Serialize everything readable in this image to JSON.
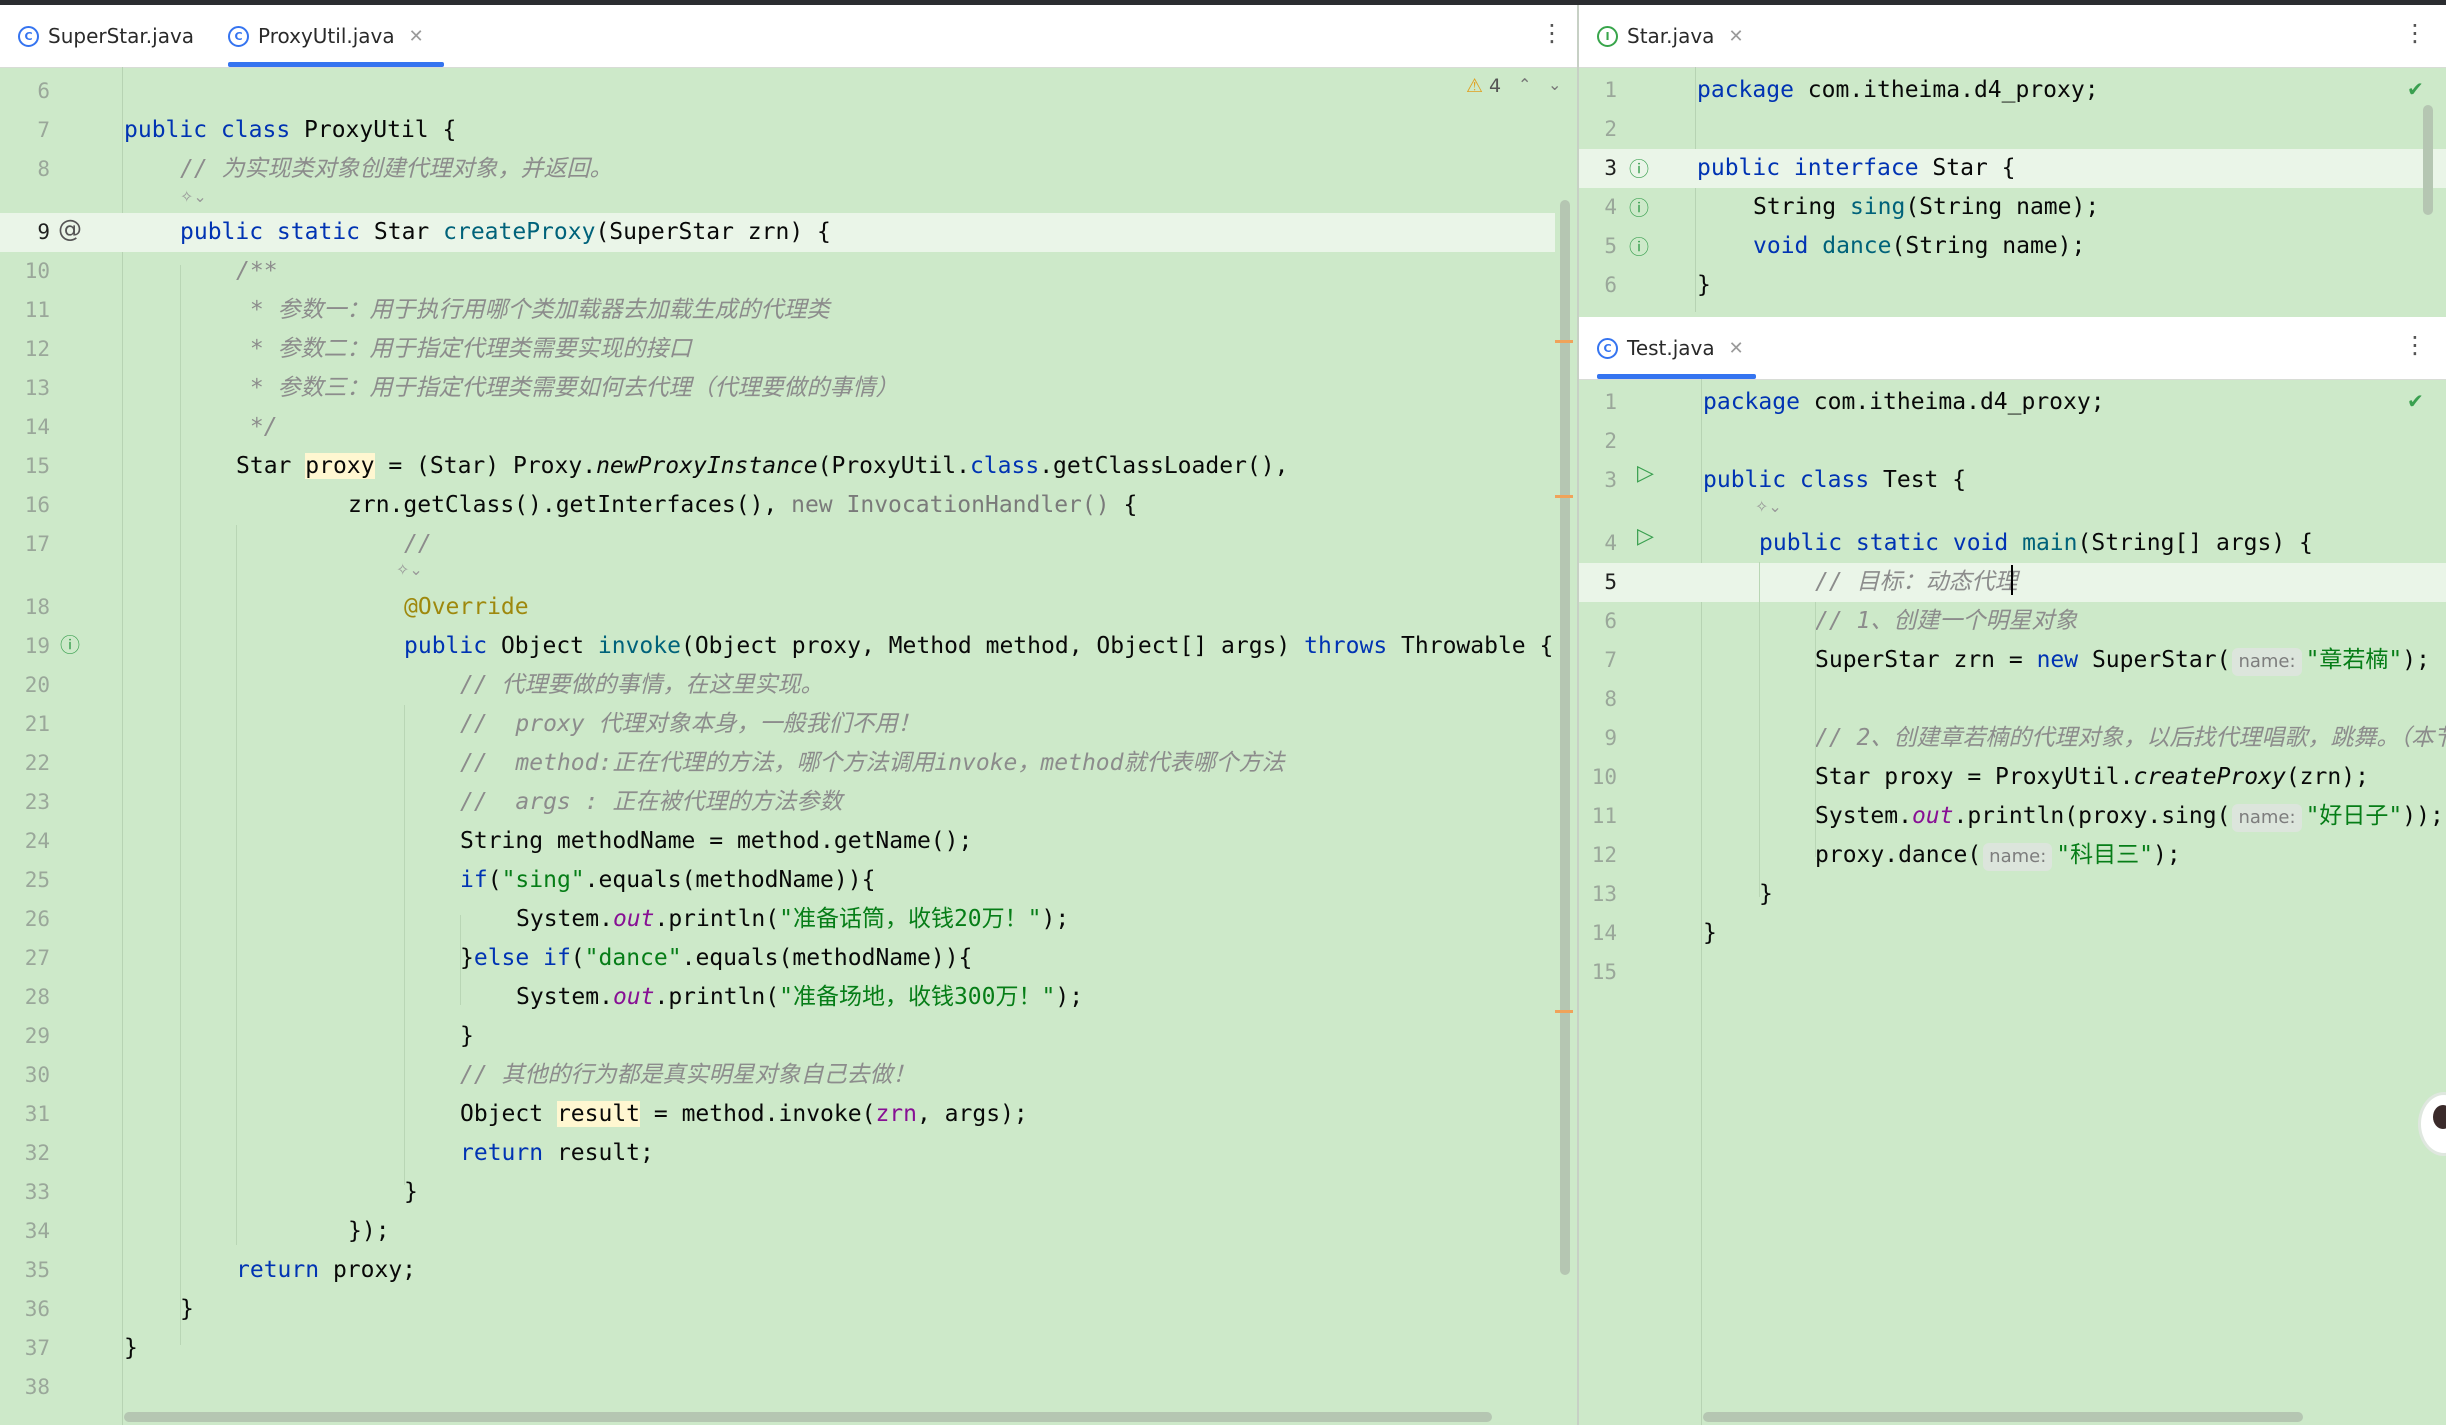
{
  "left_pane": {
    "tabs": [
      {
        "label": "SuperStar.java",
        "active": false,
        "closable": false
      },
      {
        "label": "ProxyUtil.java",
        "active": true,
        "closable": true
      }
    ],
    "problems": {
      "warnings": "4"
    },
    "lines": [
      {
        "n": "6",
        "indent": 0,
        "seg": []
      },
      {
        "n": "7",
        "indent": 0,
        "seg": [
          [
            "kw",
            "public class "
          ],
          [
            "",
            "ProxyUtil {"
          ]
        ]
      },
      {
        "n": "8",
        "indent": 1,
        "seg": [
          [
            "cm",
            "// 为实现类对象创建代理对象，并返回。"
          ]
        ]
      },
      {
        "n": "9",
        "indent": 1,
        "cur": true,
        "seg": [
          [
            "kw",
            "public static "
          ],
          [
            "",
            "Star "
          ],
          [
            "fn",
            "createProxy"
          ],
          [
            "",
            "(SuperStar zrn) {"
          ]
        ]
      },
      {
        "n": "10",
        "indent": 2,
        "seg": [
          [
            "cm",
            "/**"
          ]
        ]
      },
      {
        "n": "11",
        "indent": 2,
        "seg": [
          [
            "cm",
            " * 参数一：用于执行用哪个类加载器去加载生成的代理类"
          ]
        ]
      },
      {
        "n": "12",
        "indent": 2,
        "seg": [
          [
            "cm",
            " * 参数二：用于指定代理类需要实现的接口"
          ]
        ]
      },
      {
        "n": "13",
        "indent": 2,
        "seg": [
          [
            "cm",
            " * 参数三：用于指定代理类需要如何去代理（代理要做的事情）"
          ]
        ]
      },
      {
        "n": "14",
        "indent": 2,
        "seg": [
          [
            "cm",
            " */"
          ]
        ]
      },
      {
        "n": "15",
        "indent": 2,
        "seg": [
          [
            "",
            "Star "
          ],
          [
            "vhl",
            "proxy"
          ],
          [
            "",
            " = (Star) Proxy."
          ],
          [
            "it",
            "newProxyInstance"
          ],
          [
            "",
            "(ProxyUtil."
          ],
          [
            "kw",
            "class"
          ],
          [
            "",
            ".getClassLoader(),"
          ]
        ]
      },
      {
        "n": "16",
        "indent": 4,
        "seg": [
          [
            "",
            "zrn.getClass().getInterfaces(), "
          ],
          [
            "gy",
            "new InvocationHandler() "
          ],
          [
            "",
            "{"
          ]
        ]
      },
      {
        "n": "17",
        "indent": 5,
        "seg": [
          [
            "cm",
            "//"
          ]
        ]
      },
      {
        "n": "18",
        "indent": 5,
        "seg": [
          [
            "ann",
            "@Override"
          ]
        ]
      },
      {
        "n": "19",
        "indent": 5,
        "seg": [
          [
            "kw",
            "public "
          ],
          [
            "",
            "Object "
          ],
          [
            "fn",
            "invoke"
          ],
          [
            "",
            "(Object proxy, Method method, Object[] args) "
          ],
          [
            "kw",
            "throws "
          ],
          [
            "",
            "Throwable {"
          ]
        ]
      },
      {
        "n": "20",
        "indent": 6,
        "seg": [
          [
            "cm",
            "// 代理要做的事情，在这里实现。"
          ]
        ]
      },
      {
        "n": "21",
        "indent": 6,
        "seg": [
          [
            "cm",
            "//  proxy 代理对象本身，一般我们不用！"
          ]
        ]
      },
      {
        "n": "22",
        "indent": 6,
        "seg": [
          [
            "cm",
            "//  method:正在代理的方法，哪个方法调用invoke，method就代表哪个方法"
          ]
        ]
      },
      {
        "n": "23",
        "indent": 6,
        "seg": [
          [
            "cm",
            "//  args : 正在被代理的方法参数"
          ]
        ]
      },
      {
        "n": "24",
        "indent": 6,
        "seg": [
          [
            "",
            "String methodName = method.getName();"
          ]
        ]
      },
      {
        "n": "25",
        "indent": 6,
        "seg": [
          [
            "kw",
            "if"
          ],
          [
            "",
            "("
          ],
          [
            "str",
            "\"sing\""
          ],
          [
            "",
            ".equals(methodName)){"
          ]
        ]
      },
      {
        "n": "26",
        "indent": 7,
        "seg": [
          [
            "",
            "System."
          ],
          [
            "st",
            "out"
          ],
          [
            "",
            ".println("
          ],
          [
            "str",
            "\"准备话筒，收钱20万！\""
          ],
          [
            "",
            ");"
          ]
        ]
      },
      {
        "n": "27",
        "indent": 6,
        "seg": [
          [
            "",
            "}"
          ],
          [
            "kw",
            "else if"
          ],
          [
            "",
            "("
          ],
          [
            "str",
            "\"dance\""
          ],
          [
            "",
            ".equals(methodName)){"
          ]
        ]
      },
      {
        "n": "28",
        "indent": 7,
        "seg": [
          [
            "",
            "System."
          ],
          [
            "st",
            "out"
          ],
          [
            "",
            ".println("
          ],
          [
            "str",
            "\"准备场地，收钱300万！\""
          ],
          [
            "",
            ");"
          ]
        ]
      },
      {
        "n": "29",
        "indent": 6,
        "seg": [
          [
            "",
            "}"
          ]
        ]
      },
      {
        "n": "30",
        "indent": 6,
        "seg": [
          [
            "cm",
            "// 其他的行为都是真实明星对象自己去做！"
          ]
        ]
      },
      {
        "n": "31",
        "indent": 6,
        "seg": [
          [
            "",
            "Object "
          ],
          [
            "vhl",
            "result"
          ],
          [
            "",
            " = method.invoke("
          ],
          [
            "mb",
            "zrn"
          ],
          [
            "",
            ", args);"
          ]
        ]
      },
      {
        "n": "32",
        "indent": 6,
        "seg": [
          [
            "kw",
            "return "
          ],
          [
            "",
            "result;"
          ]
        ]
      },
      {
        "n": "33",
        "indent": 5,
        "seg": [
          [
            "",
            "}"
          ]
        ]
      },
      {
        "n": "34",
        "indent": 4,
        "seg": [
          [
            "",
            "});"
          ]
        ]
      },
      {
        "n": "35",
        "indent": 2,
        "seg": [
          [
            "kw",
            "return "
          ],
          [
            "",
            "proxy;"
          ]
        ]
      },
      {
        "n": "36",
        "indent": 1,
        "seg": [
          [
            "",
            "}"
          ]
        ]
      },
      {
        "n": "37",
        "indent": 0,
        "seg": [
          [
            "",
            "}"
          ]
        ]
      },
      {
        "n": "38",
        "indent": 0,
        "seg": []
      }
    ]
  },
  "star_pane": {
    "tab": {
      "label": "Star.java"
    },
    "lines": [
      {
        "n": "1",
        "indent": 0,
        "seg": [
          [
            "kw",
            "package "
          ],
          [
            "",
            "com.itheima.d4_proxy;"
          ]
        ]
      },
      {
        "n": "2",
        "indent": 0,
        "seg": []
      },
      {
        "n": "3",
        "indent": 0,
        "cur": true,
        "seg": [
          [
            "kw",
            "public interface "
          ],
          [
            "",
            "Star {"
          ]
        ]
      },
      {
        "n": "4",
        "indent": 1,
        "seg": [
          [
            "",
            "String "
          ],
          [
            "fn",
            "sing"
          ],
          [
            "",
            "(String name);"
          ]
        ]
      },
      {
        "n": "5",
        "indent": 1,
        "seg": [
          [
            "kw",
            "void "
          ],
          [
            "fn",
            "dance"
          ],
          [
            "",
            "(String name);"
          ]
        ]
      },
      {
        "n": "6",
        "indent": 0,
        "seg": [
          [
            "",
            "}"
          ]
        ]
      }
    ]
  },
  "test_pane": {
    "tab": {
      "label": "Test.java"
    },
    "lines": [
      {
        "n": "1",
        "indent": 0,
        "seg": [
          [
            "kw",
            "package "
          ],
          [
            "",
            "com.itheima.d4_proxy;"
          ]
        ]
      },
      {
        "n": "2",
        "indent": 0,
        "seg": []
      },
      {
        "n": "3",
        "indent": 0,
        "seg": [
          [
            "kw",
            "public class "
          ],
          [
            "",
            "Test {"
          ]
        ]
      },
      {
        "n": "4",
        "indent": 1,
        "seg": [
          [
            "kw",
            "public static void "
          ],
          [
            "fn",
            "main"
          ],
          [
            "",
            "(String[] args) {"
          ]
        ]
      },
      {
        "n": "5",
        "indent": 2,
        "cur": true,
        "seg": [
          [
            "cm",
            "// 目标：动态代理"
          ]
        ]
      },
      {
        "n": "6",
        "indent": 2,
        "seg": [
          [
            "cm",
            "// 1、创建一个明星对象"
          ]
        ]
      },
      {
        "n": "7",
        "indent": 2,
        "seg": [
          [
            "",
            "SuperStar zrn = "
          ],
          [
            "kw",
            "new "
          ],
          [
            "",
            "SuperStar("
          ],
          [
            "hint",
            "name:"
          ],
          [
            "str",
            "\"章若楠\""
          ],
          [
            "",
            ");"
          ]
        ]
      },
      {
        "n": "8",
        "indent": 0,
        "seg": []
      },
      {
        "n": "9",
        "indent": 2,
        "seg": [
          [
            "cm",
            "// 2、创建章若楠的代理对象，以后找代理唱歌，跳舞。（本节"
          ]
        ]
      },
      {
        "n": "10",
        "indent": 2,
        "seg": [
          [
            "",
            "Star proxy = ProxyUtil."
          ],
          [
            "it",
            "createProxy"
          ],
          [
            "",
            "(zrn);"
          ]
        ]
      },
      {
        "n": "11",
        "indent": 2,
        "seg": [
          [
            "",
            "System."
          ],
          [
            "st",
            "out"
          ],
          [
            "",
            ".println(proxy.sing("
          ],
          [
            "hint",
            "name:"
          ],
          [
            "str",
            "\"好日子\""
          ],
          [
            "",
            "));"
          ]
        ]
      },
      {
        "n": "12",
        "indent": 2,
        "seg": [
          [
            "",
            "proxy.dance("
          ],
          [
            "hint",
            "name:"
          ],
          [
            "str",
            "\"科目三\""
          ],
          [
            "",
            ");"
          ]
        ]
      },
      {
        "n": "13",
        "indent": 1,
        "seg": [
          [
            "",
            "}"
          ]
        ]
      },
      {
        "n": "14",
        "indent": 0,
        "seg": [
          [
            "",
            "}"
          ]
        ]
      },
      {
        "n": "15",
        "indent": 0,
        "seg": []
      }
    ]
  },
  "colors": {
    "editor_bg": "#cde9c9",
    "keyword": "#0033b3",
    "string": "#067d17",
    "comment": "#8c8c8c",
    "method": "#00627a",
    "static_field": "#871094",
    "annotation": "#9e880d",
    "accent": "#3574f0"
  }
}
